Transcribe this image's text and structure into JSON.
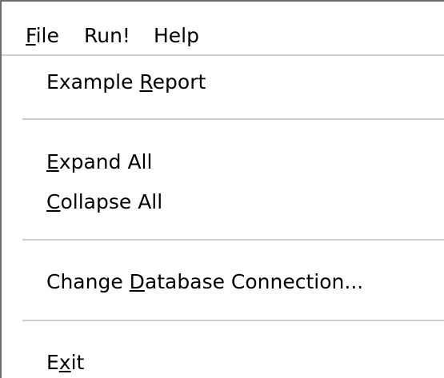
{
  "menubar": {
    "file_key": "F",
    "file_rest": "ile",
    "run": "Run!",
    "help": "Help"
  },
  "menu": {
    "example_report_pre": "Example ",
    "example_report_key": "R",
    "example_report_post": "eport",
    "expand_key": "E",
    "expand_post": "xpand All",
    "collapse_key": "C",
    "collapse_post": "ollapse All",
    "db_pre": "Change ",
    "db_key": "D",
    "db_post": "atabase Connection...",
    "exit_pre": "E",
    "exit_key": "x",
    "exit_post": "it"
  }
}
